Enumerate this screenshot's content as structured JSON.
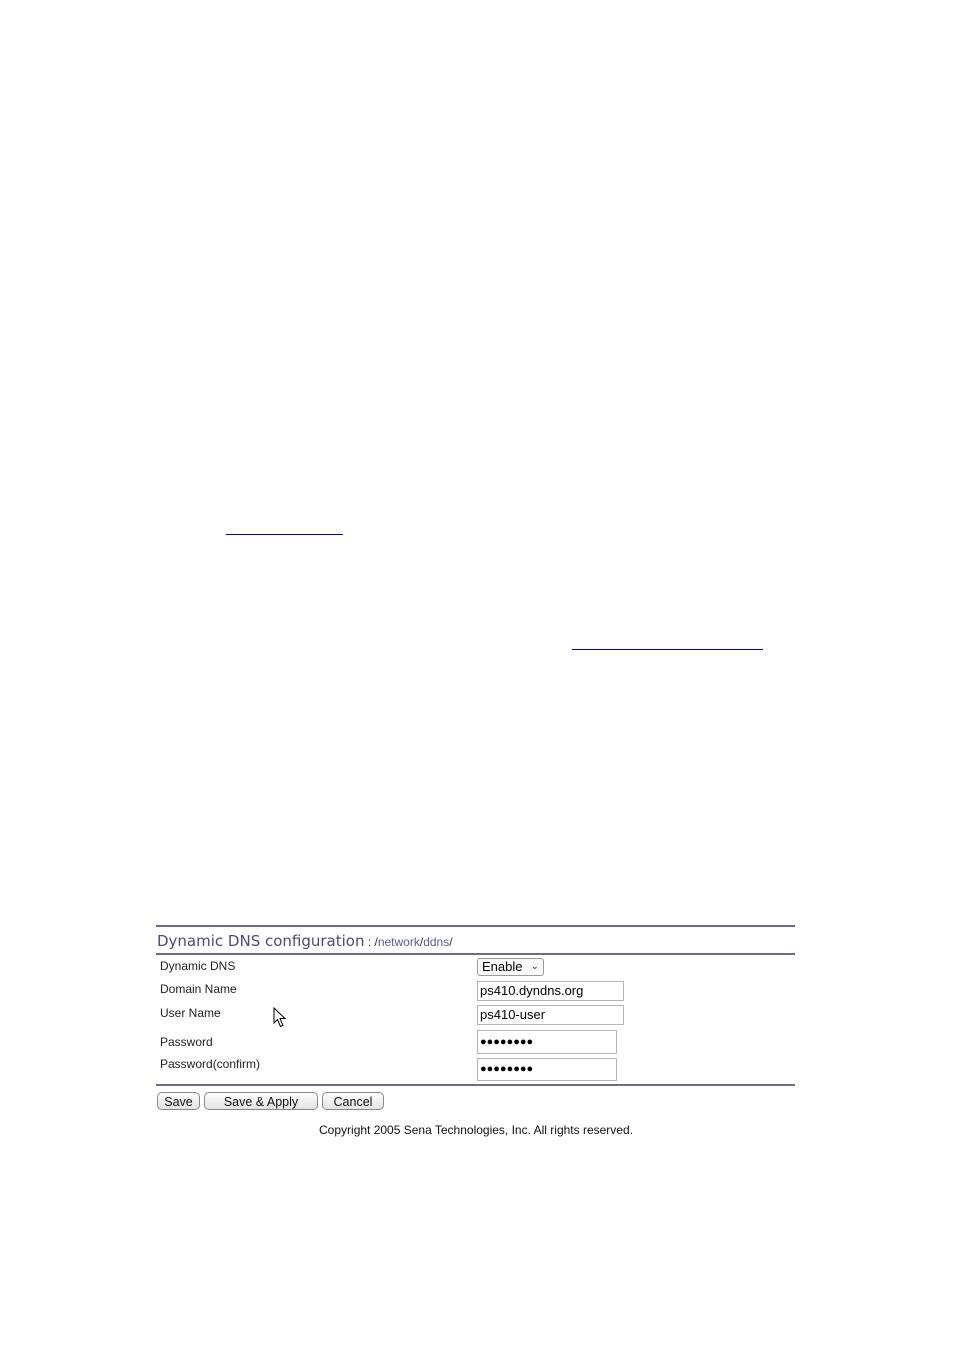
{
  "document": {
    "links": [
      {
        "text": ""
      },
      {
        "text": ""
      }
    ]
  },
  "ddns_panel": {
    "title": "Dynamic DNS configuration",
    "path_sep": " : /",
    "path": [
      "network",
      "ddns"
    ],
    "fields": [
      {
        "label": "Dynamic DNS",
        "type": "select",
        "value": "Enable"
      },
      {
        "label": "Domain Name",
        "type": "text",
        "value": "ps410.dyndns.org"
      },
      {
        "label": "User Name",
        "type": "text",
        "value": "ps410-user"
      },
      {
        "label": "Password",
        "type": "password",
        "value": "●●●●●●●●"
      },
      {
        "label": "Password(confirm)",
        "type": "password",
        "value": "●●●●●●●●"
      }
    ],
    "buttons": {
      "save": "Save",
      "save_apply": "Save & Apply",
      "cancel": "Cancel"
    },
    "copyright": "Copyright 2005 Sena Technologies, Inc. All rights reserved.",
    "icons": {
      "select_chevron": "chevron-down-icon",
      "cursor": "mouse-pointer-icon"
    }
  }
}
